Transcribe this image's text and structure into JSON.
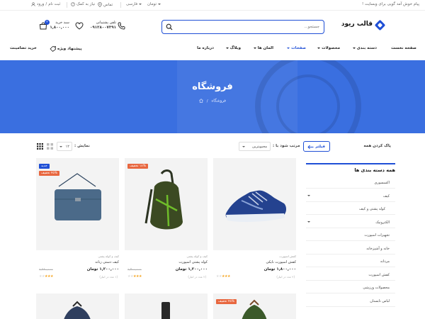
{
  "topbar": {
    "promo": "پیام خوش آمد گویی برای وبسایت !",
    "currency": "تومان",
    "language": "فارسی",
    "contact": "تماس",
    "help": "نیاز به کمک",
    "login": "ورود",
    "register": "ثبت نام",
    "separator": "/"
  },
  "header": {
    "logo": "قالب ریود",
    "search_placeholder": "جستجو...",
    "support_label": "تلفن پشتیبانی",
    "support_phone": "۰۹۱۲۸۰۰۷۳۹۱",
    "cart_label": "سبد خرید",
    "cart_total": "۱,۸۰۰,۰۰۰",
    "cart_count": "۲",
    "wishlist_count": "۰"
  },
  "nav": {
    "items": [
      {
        "label": "صفحه نخست"
      },
      {
        "label": "دسته بندی"
      },
      {
        "label": "محصولات"
      },
      {
        "label": "صفحات"
      },
      {
        "label": "المان ها"
      },
      {
        "label": "وبلاگ"
      },
      {
        "label": "درباره ما"
      }
    ],
    "special_offers": "پیشنهاد ویژه",
    "bulk_buy": "خرید تضامینت"
  },
  "hero": {
    "title": "فروشگاه",
    "breadcrumb_sep": "/",
    "breadcrumb_current": "فروشگاه"
  },
  "filters": {
    "clear_all": "پاک کردن همه",
    "filter_button": "فیلتر",
    "sort_label": "مرتب شود با :",
    "sort_value": "محبوبترین",
    "show_label": "نمایش :",
    "show_value": "۱۲"
  },
  "sidebar": {
    "title": "همه دسته بندی ها",
    "categories": [
      {
        "label": "اکسسوری",
        "toggle": ""
      },
      {
        "label": "کیف",
        "toggle": "⌄"
      },
      {
        "label": "کوله پشتی و کیف",
        "toggle": ""
      },
      {
        "label": "الکترونیک",
        "toggle": "⌄"
      },
      {
        "label": "تجهیزات اسپورت",
        "toggle": ""
      },
      {
        "label": "خانه و آشپزخانه",
        "toggle": ""
      },
      {
        "label": "مردانه",
        "toggle": ""
      },
      {
        "label": "کفش اسپورت",
        "toggle": ""
      },
      {
        "label": "محصولات ورزشی",
        "toggle": ""
      },
      {
        "label": "لباس تابستان",
        "toggle": ""
      }
    ]
  },
  "products": [
    {
      "category": "کفش اسپورت",
      "name": "کفش اسپورت نایکی",
      "price": "۱,۸۰۰,۰۰۰ تومان",
      "old_price": "",
      "stock": "(۲ عدد در انبار)",
      "rating": 3,
      "labels": []
    },
    {
      "category": "کیف و کوله پشتی",
      "name": "کوله پشتی اسپورت",
      "price": "۱,۲۰۰,۰۰۰ تومان",
      "old_price": "۱,۴۰۰,۰۰۰",
      "stock": "(۲ عدد در انبار)",
      "rating": 3,
      "labels": [
        {
          "text": "۱۸% تخفیف",
          "color": "#e8673f"
        }
      ]
    },
    {
      "category": "کیف و کوله پشتی",
      "name": "کیف دستی زنانه",
      "price": "۱,۲۰۰,۰۰۰ تومان",
      "old_price": "۱,۷۸۰,۰۰۰",
      "stock": "(۱ عدد در انبار)",
      "rating": 3,
      "labels": [
        {
          "text": "جدید",
          "color": "#1f4fd6"
        },
        {
          "text": "۲۵% تخفیف",
          "color": "#e8673f"
        }
      ]
    }
  ],
  "products_row2": [
    {
      "labels": [
        {
          "text": "۲۵% تخفیف",
          "color": "#e8673f"
        }
      ]
    },
    {
      "labels": []
    },
    {
      "labels": []
    }
  ],
  "colors": {
    "accent": "#1f4fd6",
    "discount": "#e8673f",
    "hero": "#3a6fe0"
  }
}
